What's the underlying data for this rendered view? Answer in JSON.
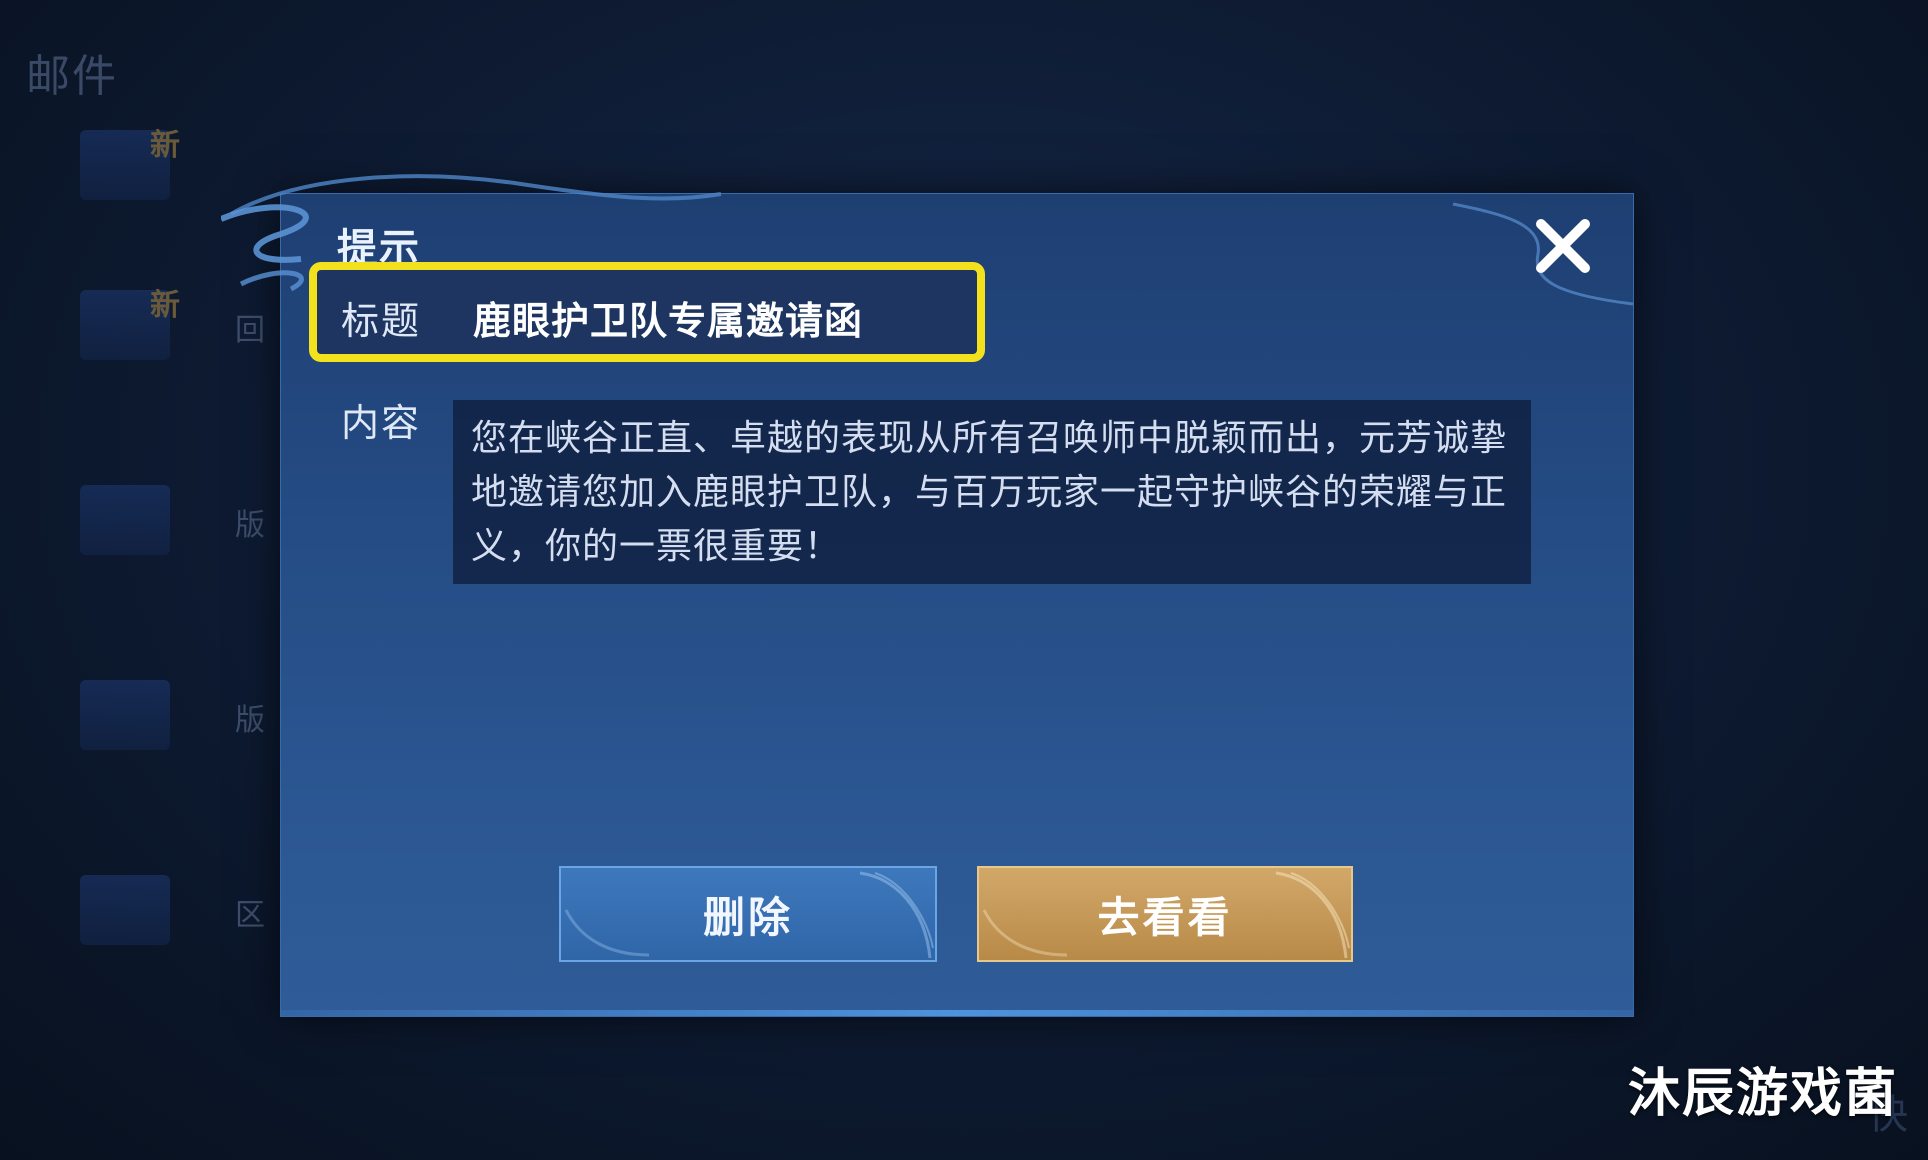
{
  "background": {
    "title": "邮件",
    "items": [
      {
        "badge": "新",
        "text": ""
      },
      {
        "badge": "新",
        "text": "回"
      },
      {
        "badge": "",
        "text": "版"
      },
      {
        "badge": "",
        "text": "版"
      },
      {
        "badge": "",
        "text": "区"
      }
    ],
    "corner_text": "快"
  },
  "dialog": {
    "title": "提示",
    "subject_label": "标题",
    "subject_value": "鹿眼护卫队专属邀请函",
    "content_label": "内容",
    "content_text": "您在峡谷正直、卓越的表现从所有召唤师中脱颖而出，元芳诚挚地邀请您加入鹿眼护卫队，与百万玩家一起守护峡谷的荣耀与正义，你的一票很重要！",
    "delete_label": "删除",
    "go_label": "去看看"
  },
  "watermark": "沐辰游戏菌",
  "colors": {
    "highlight": "#f4e11e",
    "delete_button": "#3e78bc",
    "go_button": "#c99c5c",
    "dialog_bg": "#244a82"
  }
}
